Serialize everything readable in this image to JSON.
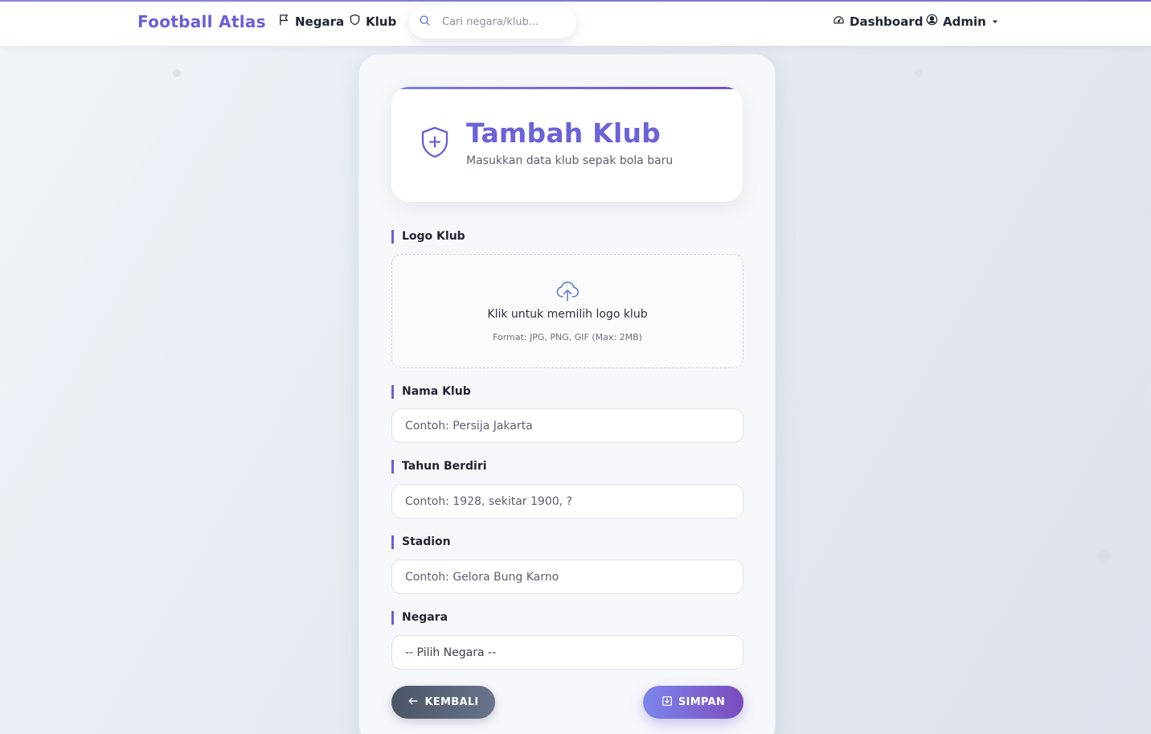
{
  "navbar": {
    "brand": "Football Atlas",
    "links": [
      {
        "label": "Negara",
        "icon": "flag-icon"
      },
      {
        "label": "Klub",
        "icon": "shield-icon"
      }
    ],
    "search_placeholder": "Cari negara/klub...",
    "right": [
      {
        "label": "Dashboard",
        "icon": "speedometer-icon"
      },
      {
        "label": "Admin",
        "icon": "user-circle-icon"
      }
    ]
  },
  "header": {
    "title": "Tambah Klub",
    "subtitle": "Masukkan data klub sepak bola baru"
  },
  "form": {
    "logo": {
      "label": "Logo Klub",
      "upload_text": "Klik untuk memilih logo klub",
      "upload_hint": "Format: JPG, PNG, GIF (Max: 2MB)"
    },
    "nama": {
      "label": "Nama Klub",
      "placeholder": "Contoh: Persija Jakarta"
    },
    "tahun": {
      "label": "Tahun Berdiri",
      "placeholder": "Contoh: 1928, sekitar 1900, ?"
    },
    "stadion": {
      "label": "Stadion",
      "placeholder": "Contoh: Gelora Bung Karno"
    },
    "negara": {
      "label": "Negara",
      "selected": "-- Pilih Negara --"
    }
  },
  "buttons": {
    "back": "KEMBALI",
    "save": "SIMPAN"
  },
  "colors": {
    "accent": "#6a5fd6",
    "accent_dark": "#7551c2",
    "back_button": "#4c5566"
  }
}
